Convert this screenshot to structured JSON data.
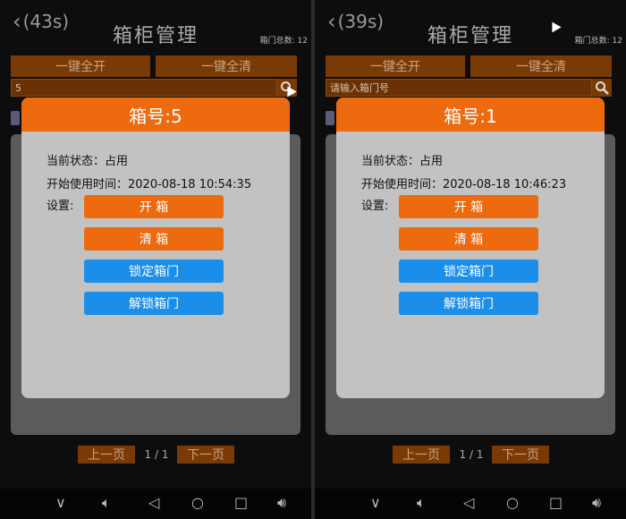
{
  "screens": [
    {
      "back_label": "(43s)",
      "title": "箱柜管理",
      "total_label": "箱门总数: 12",
      "buttons": {
        "open_all": "一键全开",
        "clear_all": "一键全清"
      },
      "search": {
        "value": "5",
        "placeholder": "请输入箱门号"
      },
      "modal": {
        "title": "箱号:5",
        "status_label": "当前状态：",
        "status_value": "占用",
        "start_label": "开始使用时间：",
        "start_value": "2020-08-18 10:54:35",
        "settings_label": "设置:",
        "actions": [
          "开 箱",
          "清 箱",
          "锁定箱门",
          "解锁箱门"
        ]
      },
      "pager": {
        "prev": "上一页",
        "info": "1 / 1",
        "next": "下一页"
      }
    },
    {
      "back_label": "(39s)",
      "title": "箱柜管理",
      "total_label": "箱门总数: 12",
      "buttons": {
        "open_all": "一键全开",
        "clear_all": "一键全清"
      },
      "search": {
        "value": "",
        "placeholder": "请输入箱门号"
      },
      "modal": {
        "title": "箱号:1",
        "status_label": "当前状态：",
        "status_value": "占用",
        "start_label": "开始使用时间：",
        "start_value": "2020-08-18 10:46:23",
        "settings_label": "设置:",
        "actions": [
          "开 箱",
          "清 箱",
          "锁定箱门",
          "解锁箱门"
        ]
      },
      "pager": {
        "prev": "上一页",
        "info": "1 / 1",
        "next": "下一页"
      }
    }
  ],
  "colors": {
    "orange": "#ee6a0f",
    "blue": "#1a8ee8",
    "dark_orange": "#7a3a06",
    "panel": "#c2c2c2"
  },
  "icons": [
    "back-chevron-icon",
    "search-icon",
    "nav-collapse-icon",
    "volume-down-icon",
    "nav-back-icon",
    "nav-home-icon",
    "nav-recents-icon",
    "volume-up-icon"
  ]
}
